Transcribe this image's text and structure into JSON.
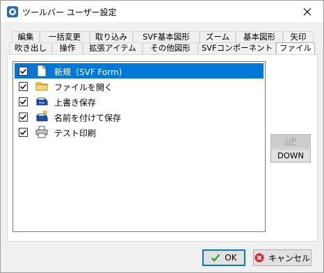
{
  "window": {
    "title": "ツールバー ユーザー設定"
  },
  "tabs_row1": [
    {
      "label": "編集"
    },
    {
      "label": "一括変更"
    },
    {
      "label": "取り込み"
    },
    {
      "label": "SVF基本図形"
    },
    {
      "label": "ズーム"
    },
    {
      "label": "基本図形"
    },
    {
      "label": "矢印"
    }
  ],
  "tabs_row2": [
    {
      "label": "吹き出し"
    },
    {
      "label": "操作"
    },
    {
      "label": "拡張アイテム"
    },
    {
      "label": "その他図形"
    },
    {
      "label": "SVFコンポーネント"
    },
    {
      "label": "ファイル",
      "selected": true
    }
  ],
  "list": {
    "items": [
      {
        "label": "新規（SVF Form)",
        "checked": true,
        "icon": "new-document-icon",
        "selected": true
      },
      {
        "label": "ファイルを開く",
        "checked": true,
        "icon": "open-folder-icon"
      },
      {
        "label": "上書き保存",
        "checked": true,
        "icon": "save-icon"
      },
      {
        "label": "名前を付けて保存",
        "checked": true,
        "icon": "save-as-icon"
      },
      {
        "label": "テスト印刷",
        "checked": true,
        "icon": "printer-icon"
      }
    ]
  },
  "side_buttons": {
    "up": "UP",
    "down": "DOWN"
  },
  "footer": {
    "ok": "OK",
    "cancel": "キャンセル"
  },
  "colors": {
    "selection": "#0078d7",
    "ok_border": "#0078d7"
  }
}
